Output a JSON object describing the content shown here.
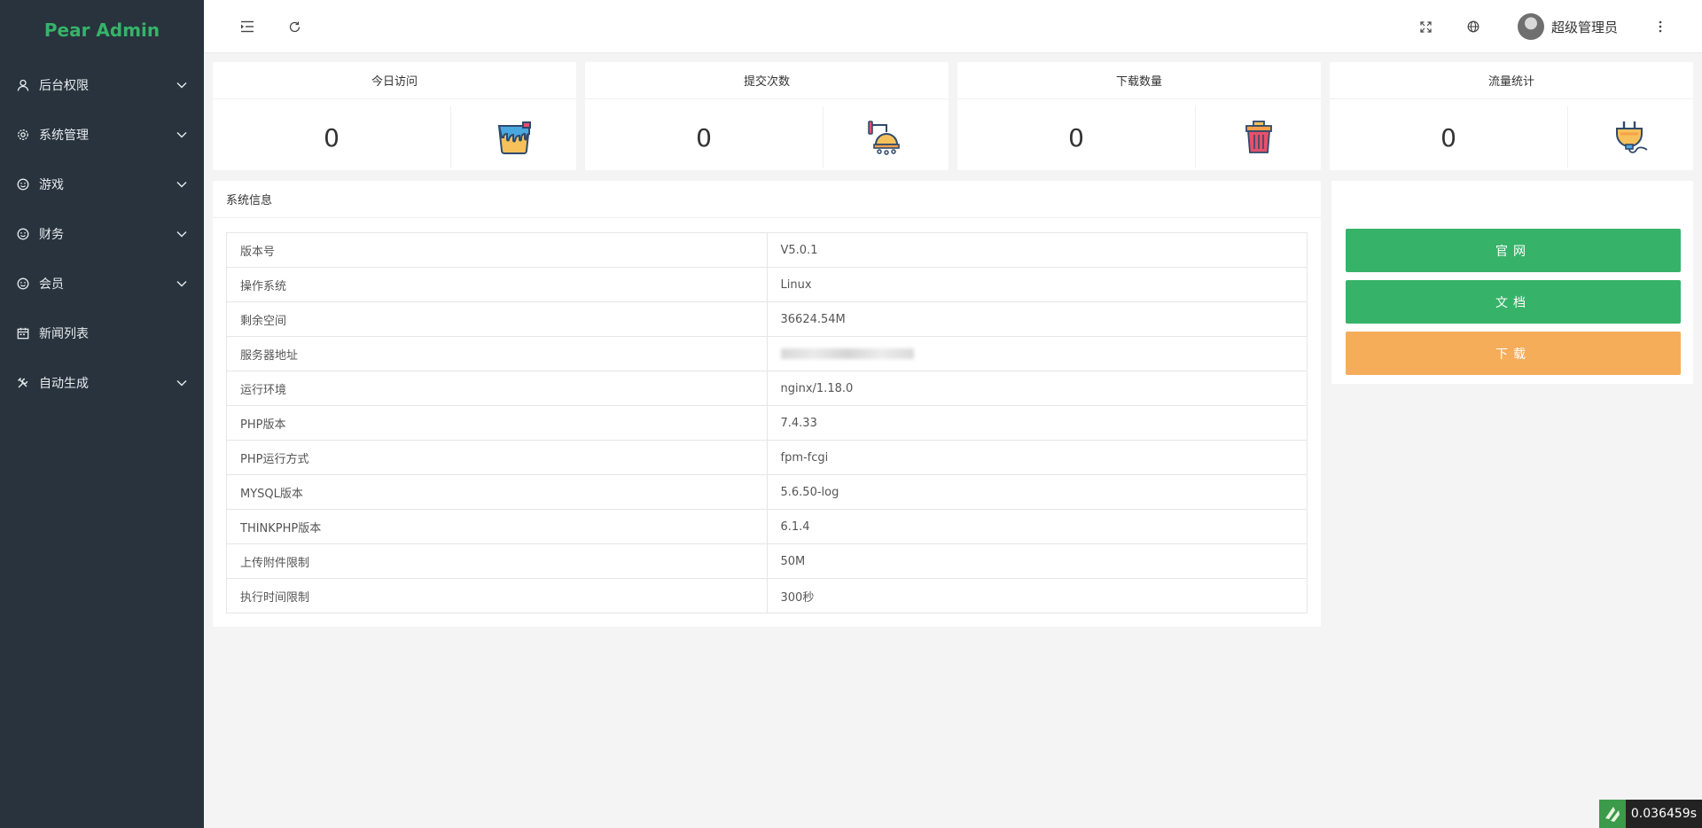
{
  "sidebar": {
    "logo": "Pear Admin",
    "items": [
      {
        "label": "后台权限",
        "icon": "user-icon",
        "has_children": true
      },
      {
        "label": "系统管理",
        "icon": "gear-icon",
        "has_children": true
      },
      {
        "label": "游戏",
        "icon": "smile-icon",
        "has_children": true
      },
      {
        "label": "财务",
        "icon": "smile-icon",
        "has_children": true
      },
      {
        "label": "会员",
        "icon": "smile-icon",
        "has_children": true
      },
      {
        "label": "新闻列表",
        "icon": "calendar-icon",
        "has_children": false
      },
      {
        "label": "自动生成",
        "icon": "tools-icon",
        "has_children": true
      }
    ]
  },
  "header": {
    "user_name": "超级管理员",
    "icons": [
      "menu-collapse-icon",
      "refresh-icon",
      "fullscreen-icon",
      "globe-icon",
      "more-vertical-icon"
    ]
  },
  "stats": [
    {
      "title": "今日访问",
      "value": "0",
      "icon": "paint-bucket-icon"
    },
    {
      "title": "提交次数",
      "value": "0",
      "icon": "shower-icon"
    },
    {
      "title": "下载数量",
      "value": "0",
      "icon": "trash-bin-icon"
    },
    {
      "title": "流量统计",
      "value": "0",
      "icon": "plug-icon"
    }
  ],
  "system_info": {
    "title": "系统信息",
    "rows": [
      {
        "key": "版本号",
        "value": "V5.0.1"
      },
      {
        "key": "操作系统",
        "value": "Linux"
      },
      {
        "key": "剩余空间",
        "value": "36624.54M"
      },
      {
        "key": "服务器地址",
        "value": ""
      },
      {
        "key": "运行环境",
        "value": "nginx/1.18.0"
      },
      {
        "key": "PHP版本",
        "value": "7.4.33"
      },
      {
        "key": "PHP运行方式",
        "value": "fpm-fcgi"
      },
      {
        "key": "MYSQL版本",
        "value": "5.6.50-log"
      },
      {
        "key": "THINKPHP版本",
        "value": "6.1.4"
      },
      {
        "key": "上传附件限制",
        "value": "50M"
      },
      {
        "key": "执行时间限制",
        "value": "300秒"
      }
    ]
  },
  "links": {
    "official_site": "官网",
    "docs": "文档",
    "download": "下载"
  },
  "timer": "0.036459s",
  "colors": {
    "brand_green": "#36b368",
    "orange": "#f5ad5a",
    "sidebar_bg": "#28333e"
  }
}
